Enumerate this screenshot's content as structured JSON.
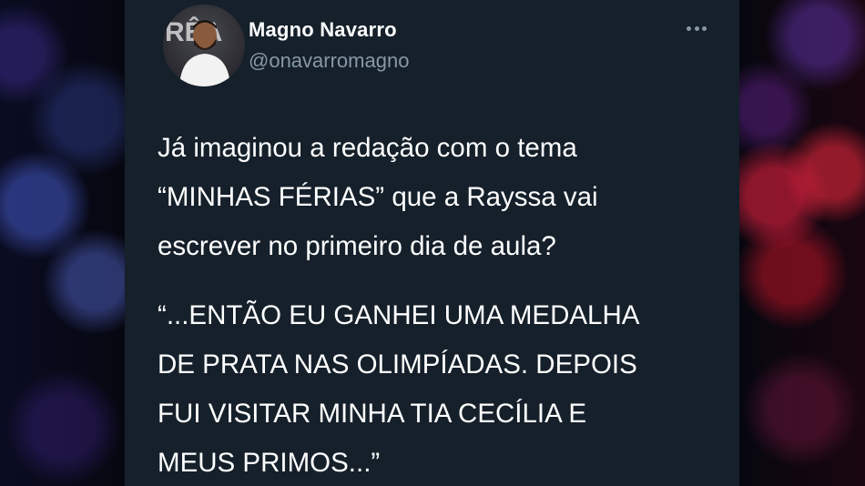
{
  "tweet": {
    "author": {
      "name": "Magno Navarro",
      "handle": "@onavarromagno",
      "avatar_icon": "profile-photo",
      "avatar_text": "RÊA"
    },
    "more_icon": "ellipsis-icon",
    "paragraphs": [
      {
        "lines": [
          "Já imaginou a redação com o tema",
          "“MINHAS FÉRIAS” que a Rayssa vai",
          "escrever no primeiro dia de aula?"
        ]
      },
      {
        "lines": [
          "“...ENTÃO EU GANHEI UMA MEDALHA",
          "DE PRATA NAS OLIMPÍADAS. DEPOIS",
          "FUI VISITAR MINHA TIA CECÍLIA E",
          "MEUS PRIMOS...”"
        ]
      }
    ]
  },
  "colors": {
    "card_background": "#15202b",
    "text_primary": "#ffffff",
    "text_secondary": "#8899a6"
  }
}
